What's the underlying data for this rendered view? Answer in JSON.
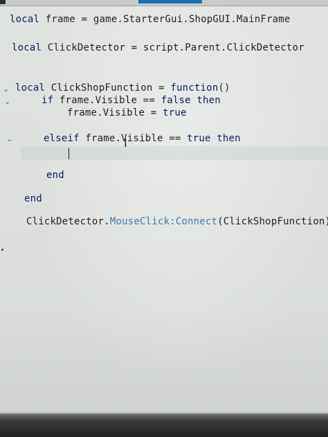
{
  "editor": {
    "lines": {
      "l1": {
        "kw": "local",
        "rest": " frame = game.StarterGui.ShopGUI.MainFrame"
      },
      "l2": {
        "kw": "local",
        "rest": " ClickDetector = script.Parent.ClickDetector"
      },
      "l3": {
        "kw": "local",
        "rest": " ClickShopFunction = ",
        "kw_b": "function",
        "rest_b": "()"
      },
      "l4": {
        "kw": "if",
        "rest": " frame.Visible == ",
        "kw_b": "false",
        "mid": " ",
        "kw_c": "then"
      },
      "l5": {
        "rest": "frame.Visible = ",
        "kw_b": "true"
      },
      "l6": {
        "kw": "elseif",
        "rest": " frame.Visible == ",
        "kw_b": "true",
        "mid": " ",
        "kw_c": "then"
      },
      "l7": {
        "kw": "end"
      },
      "l8": {
        "kw": "end"
      },
      "l9": {
        "id_a": "ClickDetector.",
        "prop_a": "MouseClick",
        "op_a": ":",
        "prop_b": "Connect",
        "rest": "(ClickShopFunction)"
      }
    },
    "fold_glyph": "⌄",
    "cursor_glyph": "I"
  },
  "colors": {
    "keyword": "#0a1f6b",
    "text": "#1f2328",
    "member": "#3a7fb0",
    "background": "#e4e6e3",
    "tab_accent": "#1c6fb4"
  }
}
